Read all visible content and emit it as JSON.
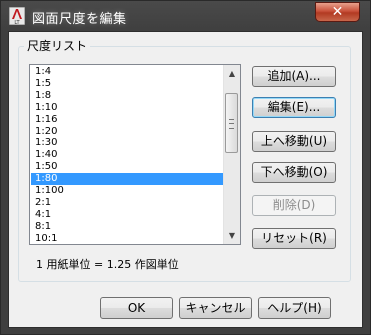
{
  "window": {
    "title": "図面尺度を編集",
    "close_label": "✕",
    "accent_color": "#3399ff"
  },
  "group": {
    "label": "尺度リスト"
  },
  "scale_list": {
    "items": [
      "1:4",
      "1:5",
      "1:8",
      "1:10",
      "1:16",
      "1:20",
      "1:30",
      "1:40",
      "1:50",
      "1:80",
      "1:100",
      "2:1",
      "4:1",
      "8:1",
      "10:1"
    ],
    "selected": "1:80"
  },
  "side_buttons": {
    "add": "追加(A)...",
    "edit": "編集(E)...",
    "move_up": "上へ移動(U)",
    "move_down": "下へ移動(O)",
    "delete": "削除(D)",
    "reset": "リセット(R)"
  },
  "scale_info": "1 用紙単位 = 1.25 作図単位",
  "footer_buttons": {
    "ok": "OK",
    "cancel": "キャンセル",
    "help": "ヘルプ(H)"
  },
  "icons": {
    "app": "autocad-lt-icon",
    "scroll_up": "arrow-up-icon",
    "scroll_down": "arrow-down-icon"
  }
}
